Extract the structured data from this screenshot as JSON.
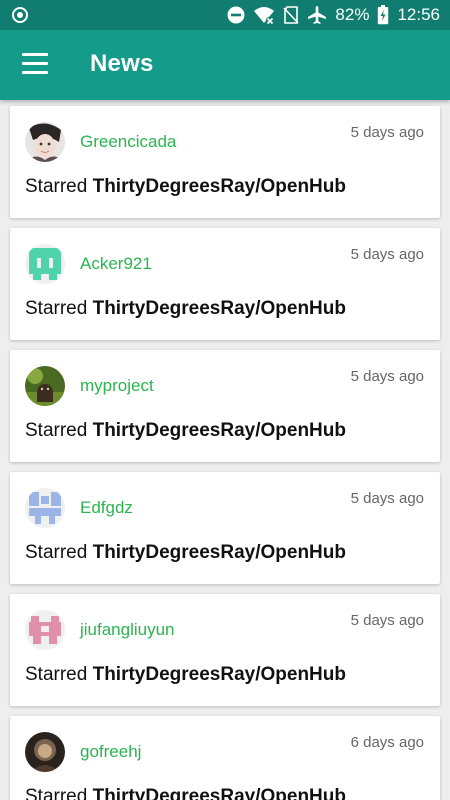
{
  "status_bar": {
    "battery": "82%",
    "time": "12:56"
  },
  "app_bar": {
    "title": "News"
  },
  "feed": [
    {
      "user": "Greencicada",
      "time": "5 days ago",
      "action": "Starred",
      "repo": "ThirtyDegreesRay/OpenHub",
      "avatar": "photo-portrait"
    },
    {
      "user": "Acker921",
      "time": "5 days ago",
      "action": "Starred",
      "repo": "ThirtyDegreesRay/OpenHub",
      "avatar": "identicon-green"
    },
    {
      "user": "myproject",
      "time": "5 days ago",
      "action": "Starred",
      "repo": "ThirtyDegreesRay/OpenHub",
      "avatar": "photo-android"
    },
    {
      "user": "Edfgdz",
      "time": "5 days ago",
      "action": "Starred",
      "repo": "ThirtyDegreesRay/OpenHub",
      "avatar": "identicon-blue"
    },
    {
      "user": "jiufangliuyun",
      "time": "5 days ago",
      "action": "Starred",
      "repo": "ThirtyDegreesRay/OpenHub",
      "avatar": "identicon-pink"
    },
    {
      "user": "gofreehj",
      "time": "6 days ago",
      "action": "Starred",
      "repo": "ThirtyDegreesRay/OpenHub",
      "avatar": "photo-dark"
    }
  ],
  "colors": {
    "status_bar": "#117d70",
    "app_bar": "#159b8a",
    "username": "#2bb550"
  }
}
